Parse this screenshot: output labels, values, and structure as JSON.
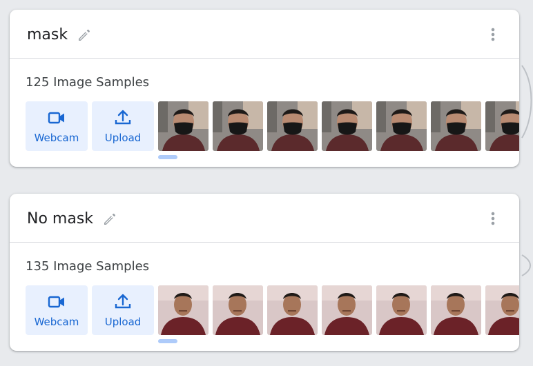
{
  "classes": [
    {
      "name": "mask",
      "sample_count": "125 Image Samples",
      "webcam_label": "Webcam",
      "upload_label": "Upload",
      "thumbnail_count_visible": 7,
      "thumbnail_subject": "person-wearing-black-mask"
    },
    {
      "name": "No mask",
      "sample_count": "135 Image Samples",
      "webcam_label": "Webcam",
      "upload_label": "Upload",
      "thumbnail_count_visible": 7,
      "thumbnail_subject": "person-without-mask"
    }
  ],
  "colors": {
    "background": "#e8eaed",
    "card": "#ffffff",
    "accent_blue": "#1967d2",
    "button_bg": "#e8f0fe",
    "scroll_indicator": "#aecbfa"
  },
  "icons": [
    "edit-pencil-icon",
    "more-vert-icon",
    "videocam-icon",
    "upload-icon"
  ]
}
